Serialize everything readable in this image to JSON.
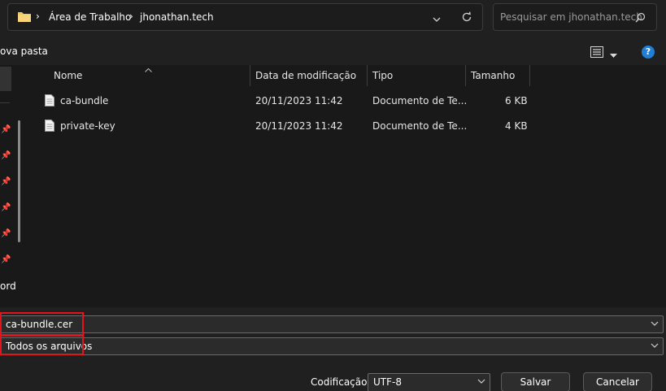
{
  "breadcrumb": {
    "items": [
      "Área de Trabalho",
      "jhonathan.tech"
    ]
  },
  "search": {
    "placeholder": "Pesquisar em jhonathan.tech"
  },
  "toolbar": {
    "new_folder_label": "ova pasta",
    "help_label": "?"
  },
  "navpane": {
    "partial_label": "ord"
  },
  "file_list": {
    "columns": [
      "Nome",
      "Data de modificação",
      "Tipo",
      "Tamanho"
    ],
    "rows": [
      {
        "name": "ca-bundle",
        "date": "20/11/2023 11:42",
        "type": "Documento de Te...",
        "size": "6 KB"
      },
      {
        "name": "private-key",
        "date": "20/11/2023 11:42",
        "type": "Documento de Te...",
        "size": "4 KB"
      }
    ]
  },
  "filename": {
    "value": "ca-bundle.cer"
  },
  "filetype": {
    "value": "Todos os arquivos"
  },
  "encoding": {
    "label": "Codificação:",
    "value": "UTF-8"
  },
  "buttons": {
    "save_label": "Salvar",
    "cancel_label": "Cancelar"
  },
  "colors": {
    "highlight": "#e4141b",
    "help_icon": "#1f7fd6",
    "folder": "#f2c65a"
  }
}
